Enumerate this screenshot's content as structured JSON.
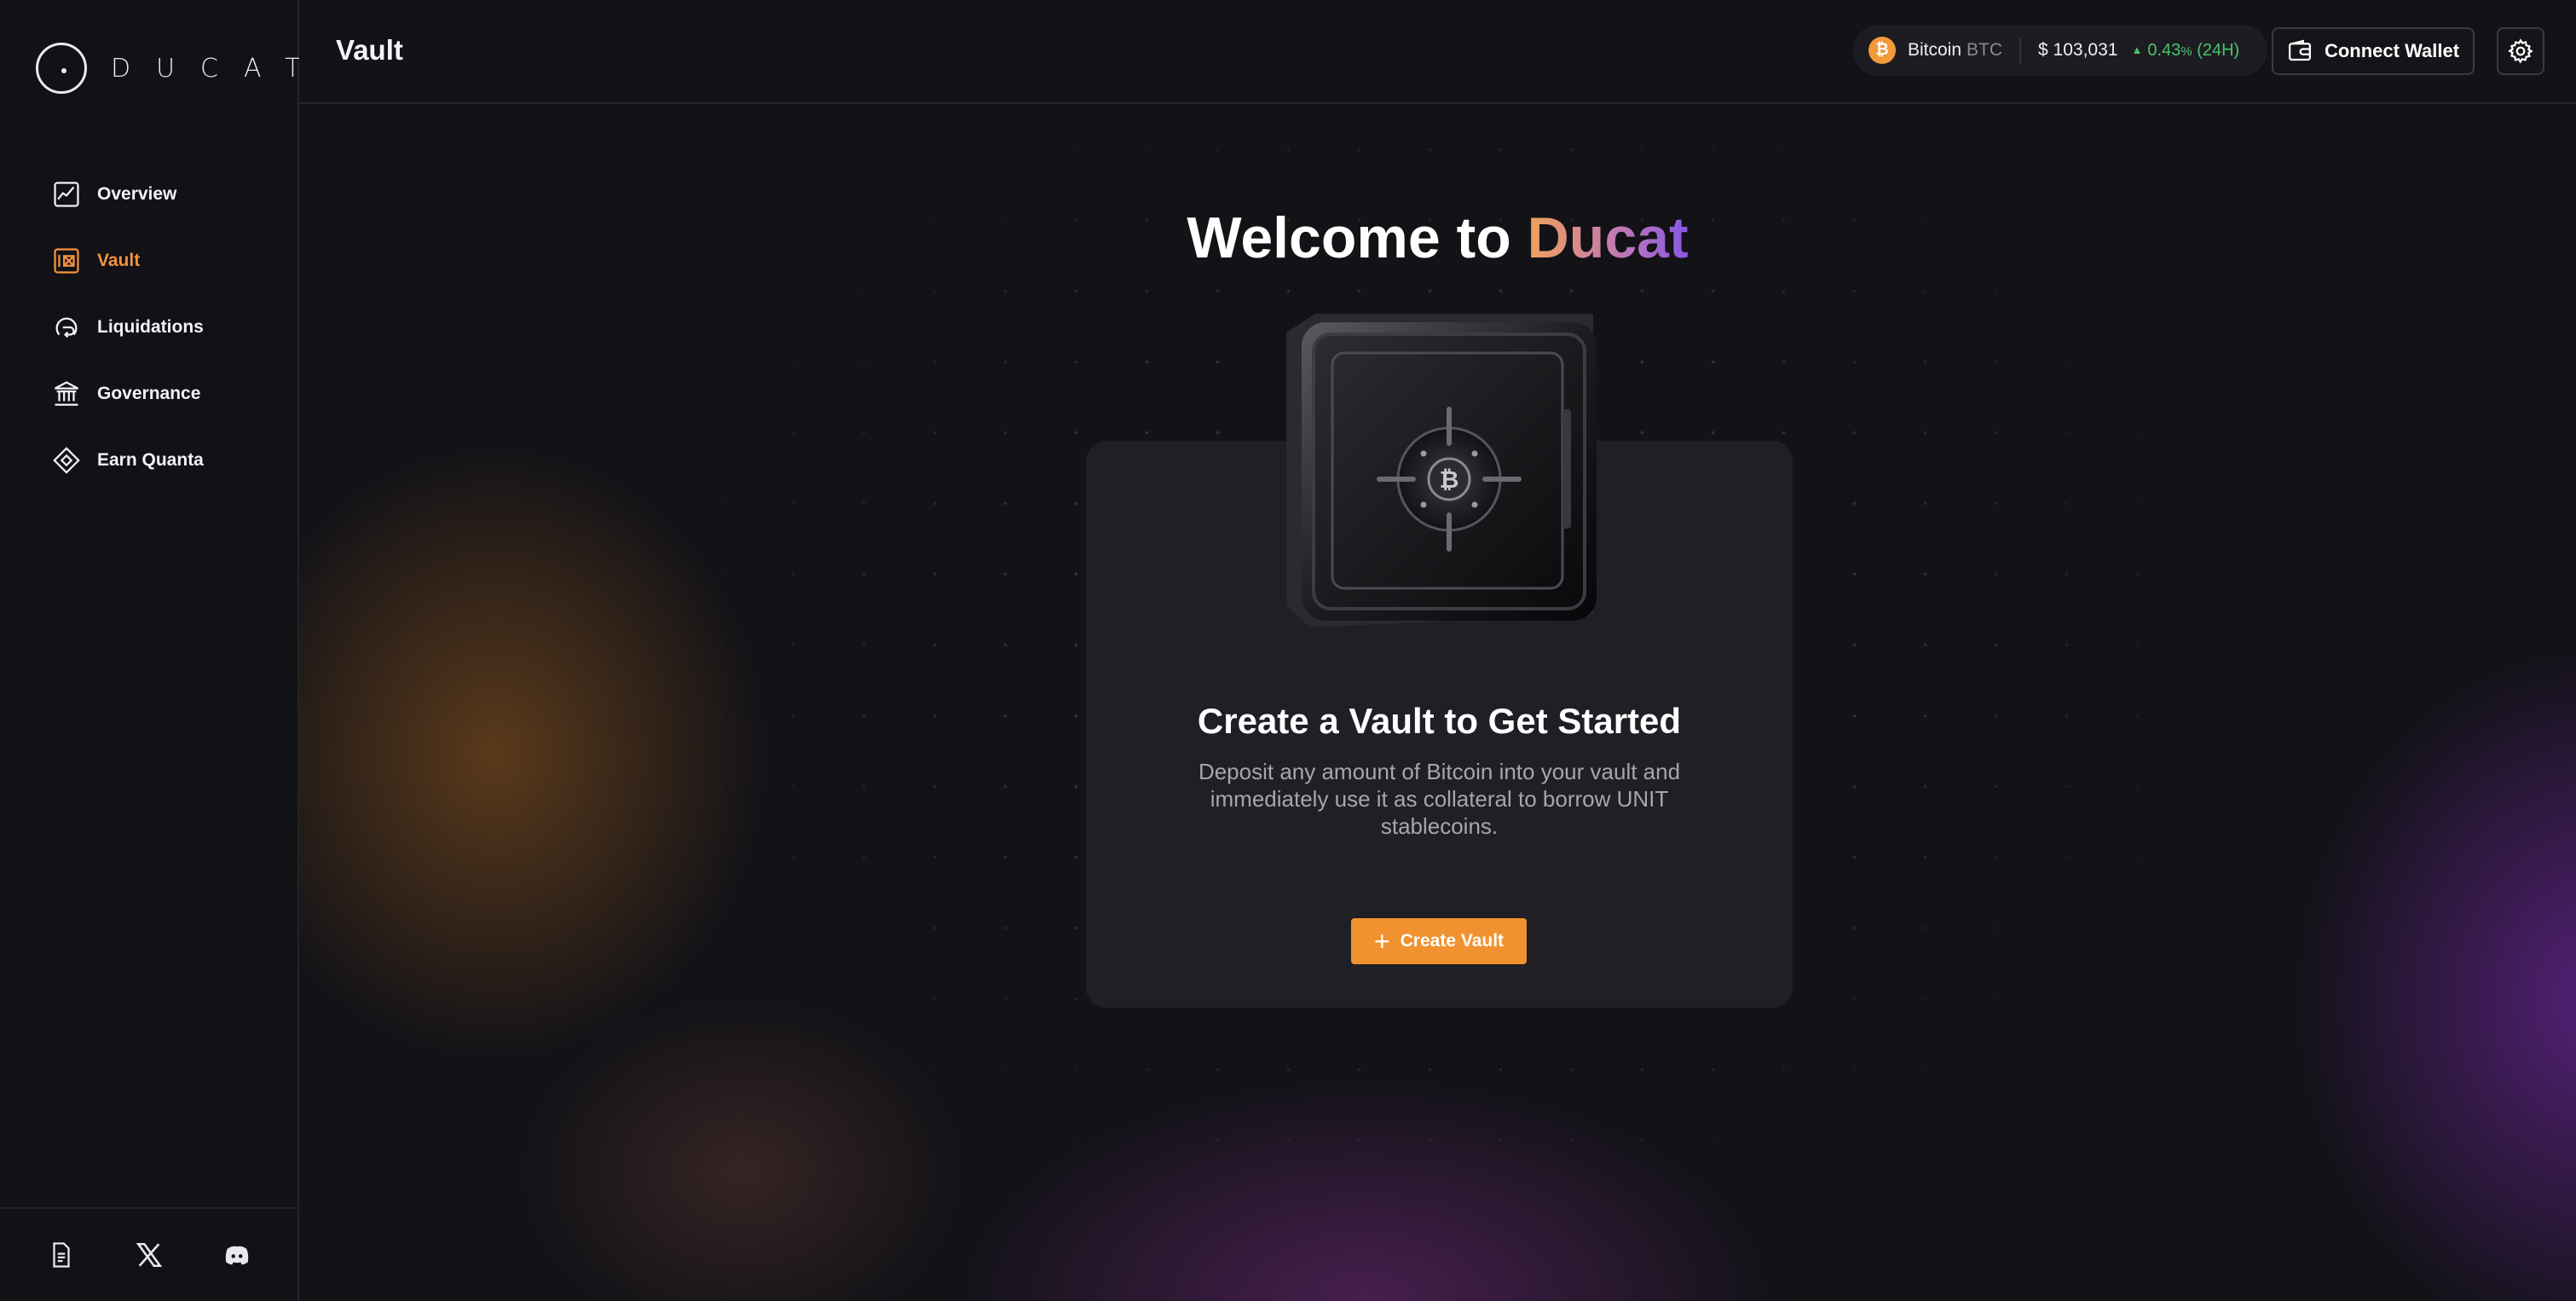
{
  "brand": {
    "name": "DUCAT"
  },
  "sidebar": {
    "items": [
      {
        "label": "Overview",
        "icon": "chart-line-icon"
      },
      {
        "label": "Vault",
        "icon": "vault-icon",
        "active": true
      },
      {
        "label": "Liquidations",
        "icon": "liquidations-icon"
      },
      {
        "label": "Governance",
        "icon": "bank-icon"
      },
      {
        "label": "Earn Quanta",
        "icon": "diamond-icon"
      }
    ],
    "footer_icons": [
      "document-icon",
      "x-icon",
      "discord-icon"
    ]
  },
  "header": {
    "title": "Vault",
    "price": {
      "coin": "Bitcoin",
      "ticker": "BTC",
      "price": "$ 103,031",
      "change": "0.43",
      "change_unit": "%",
      "period": "(24H)"
    },
    "connect_label": "Connect Wallet"
  },
  "main": {
    "welcome_prefix": "Welcome to",
    "welcome_brand": "Ducat",
    "card_title": "Create a Vault to Get Started",
    "card_desc": "Deposit any amount of Bitcoin into your vault and immediately use it as collateral to borrow UNIT stablecoins.",
    "create_label": "Create Vault"
  },
  "colors": {
    "accent": "#f0922f",
    "positive": "#4cc36a",
    "background": "#111116",
    "card": "#1f1f25"
  }
}
